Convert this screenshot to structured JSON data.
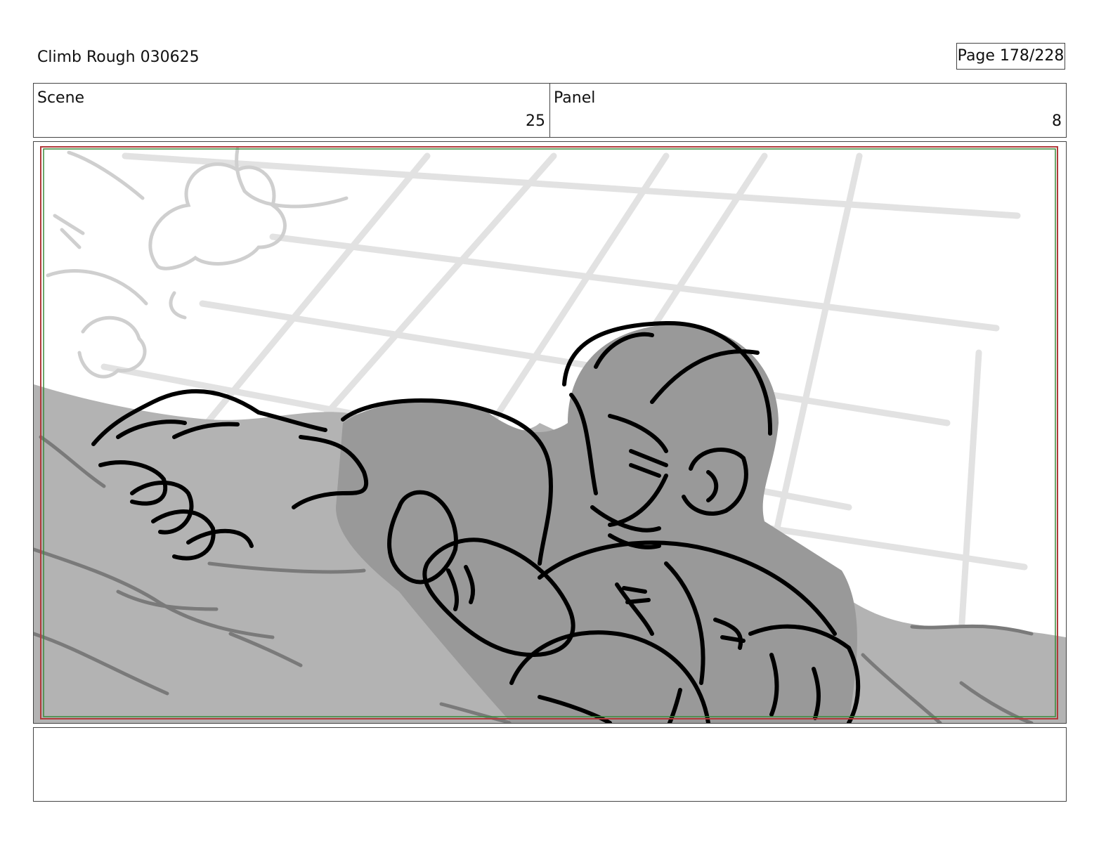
{
  "document": {
    "title": "Climb Rough 030625",
    "page_label": "Page 178/228"
  },
  "info": {
    "scene_label": "Scene",
    "scene_number": "25",
    "panel_label": "Panel",
    "panel_number": "8"
  },
  "notes": {
    "text": ""
  },
  "colors": {
    "safe_frame_red": "#b03a3a",
    "safe_frame_green": "#3a8a3a",
    "ink": "#000000",
    "fill_gray": "#999999",
    "rock_gray": "#b3b3b3",
    "sketch_gray": "#e0e0e0"
  }
}
